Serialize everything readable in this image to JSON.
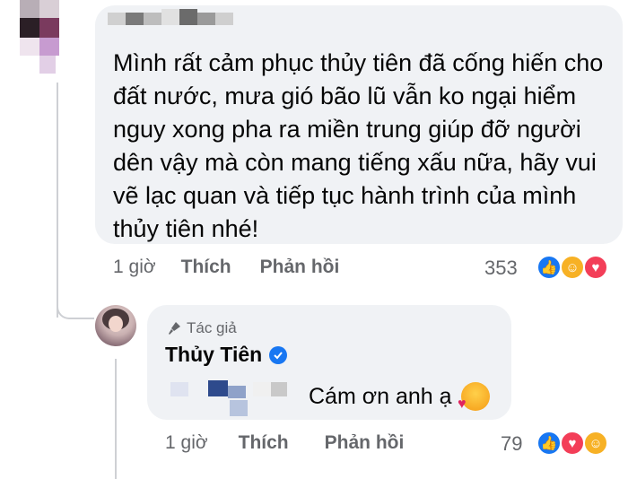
{
  "comment": {
    "author_label": "",
    "text": "Mình rất cảm phục thủy tiên đã cống hiến cho đất nước, mưa gió bão lũ vẫn ko ngại hiểm nguy xong pha ra miền trung giúp đỡ người dên vậy mà còn mang tiếng xấu nữa, hãy vui vẽ lạc quan và tiếp tục hành trình của mình thủy tiên nhé!",
    "time": "1 giờ",
    "like_label": "Thích",
    "reply_label": "Phản hồi",
    "reaction_count": "353",
    "reactions": [
      "like",
      "haha",
      "love"
    ]
  },
  "reply": {
    "author_tag": "Tác giả",
    "author_name": "Thủy Tiên",
    "verified": true,
    "text": "Cám ơn anh ạ",
    "emoji": "smiling-face-with-hearts",
    "time": "1 giờ",
    "like_label": "Thích",
    "reply_label": "Phản hồi",
    "reaction_count": "79",
    "reactions": [
      "like",
      "love",
      "haha"
    ]
  },
  "colors": {
    "bubble": "#f0f2f5",
    "secondary_text": "#65676b",
    "like": "#1877f2",
    "love": "#f33e58",
    "haha": "#f7b125"
  }
}
